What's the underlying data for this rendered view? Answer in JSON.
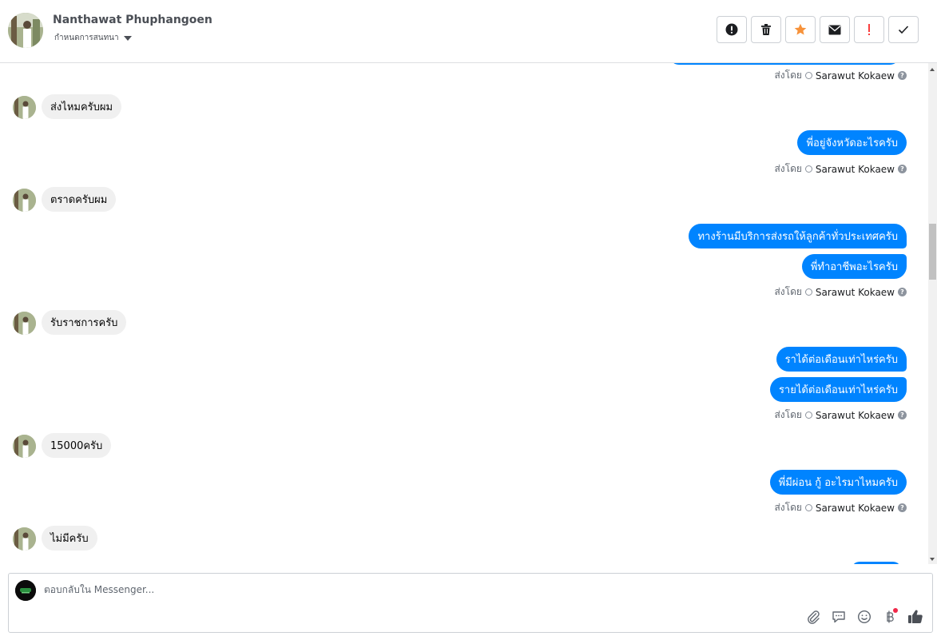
{
  "header": {
    "contact_name": "Nanthawat Phuphangoen",
    "stage_label": "กำหนดการสนทนา",
    "toolbar": [
      {
        "name": "info-button",
        "icon": "exclamation-circle-icon"
      },
      {
        "name": "delete-button",
        "icon": "trash-icon"
      },
      {
        "name": "star-button",
        "icon": "star-icon",
        "color": "#f7923a"
      },
      {
        "name": "mark-unread-button",
        "icon": "envelope-icon"
      },
      {
        "name": "spam-button",
        "icon": "exclamation-icon",
        "color": "#fa3e3e"
      },
      {
        "name": "mark-done-button",
        "icon": "check-icon"
      }
    ]
  },
  "thread": {
    "sent_by_label": "ส่งโดย",
    "agent_name": "Sarawut Kokaew",
    "help_glyph": "?",
    "messages": [
      {
        "from": "them",
        "text": "ส่งไหมครับผม"
      },
      {
        "from": "me",
        "text": "พี่อยู่จังหวัดอะไรครับ"
      },
      {
        "from": "them",
        "text": "ตราดครับผม"
      },
      {
        "from": "me",
        "text": "ทางร้านมีบริการส่งรถให้ลูกค้าทั่วประเทศครับ"
      },
      {
        "from": "me",
        "text": "พี่ทำอาชีพอะไรครับ"
      },
      {
        "from": "them",
        "text": "รับราชการครับ"
      },
      {
        "from": "me",
        "text": "ราได้ต่อเดือนเท่าไหร่ครับ"
      },
      {
        "from": "me",
        "text": "รายได้ต่อเดือนเท่าไหร่ครับ"
      },
      {
        "from": "them",
        "text": "15000ครับ"
      },
      {
        "from": "me",
        "text": "พี่มีผ่อน กู้ อะไรมาไหมครับ"
      },
      {
        "from": "them",
        "text": "ไม่มีครับ"
      }
    ]
  },
  "composer": {
    "placeholder": "ตอบกลับใน Messenger...",
    "icons": [
      "paperclip-icon",
      "saved-reply-icon",
      "emoji-icon",
      "baht-payment-icon",
      "thumbs-up-icon"
    ]
  },
  "colors": {
    "outgoing_bubble": "#0084ff",
    "incoming_bubble": "#f0f0f0",
    "notification_dot": "#f02849"
  }
}
